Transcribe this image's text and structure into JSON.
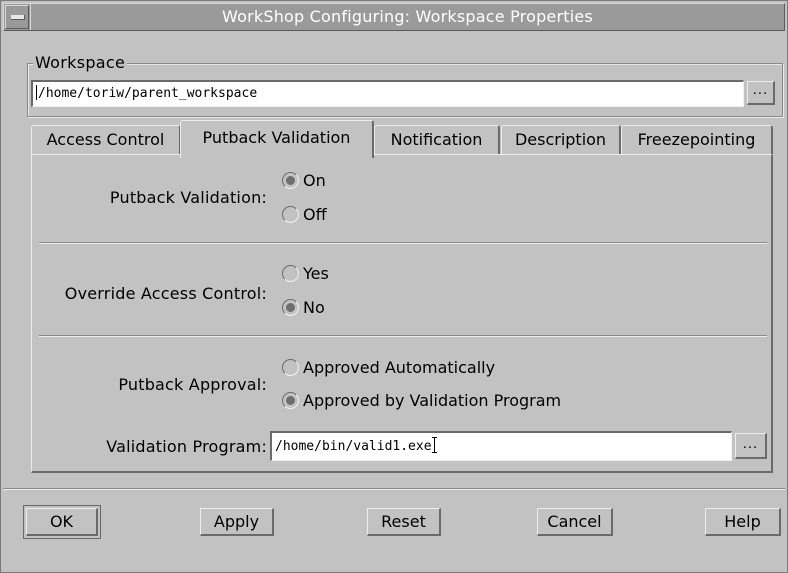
{
  "window": {
    "title": "WorkShop Configuring: Workspace Properties"
  },
  "workspace": {
    "label": "Workspace",
    "path": "/home/toriw/parent_workspace",
    "browse_label": "..."
  },
  "tabs": [
    {
      "label": "Access Control",
      "active": false
    },
    {
      "label": "Putback Validation",
      "active": true
    },
    {
      "label": "Notification",
      "active": false
    },
    {
      "label": "Description",
      "active": false
    },
    {
      "label": "Freezepointing",
      "active": false
    }
  ],
  "putback_validation": {
    "label": "Putback Validation:",
    "options": [
      "On",
      "Off"
    ],
    "selected": "On"
  },
  "override_access_control": {
    "label": "Override Access Control:",
    "options": [
      "Yes",
      "No"
    ],
    "selected": "No"
  },
  "putback_approval": {
    "label": "Putback Approval:",
    "options": [
      "Approved Automatically",
      "Approved by Validation Program"
    ],
    "selected": "Approved by Validation Program"
  },
  "validation_program": {
    "label": "Validation Program:",
    "value": "/home/bin/valid1.exe",
    "browse_label": "..."
  },
  "buttons": {
    "ok": "OK",
    "apply": "Apply",
    "reset": "Reset",
    "cancel": "Cancel",
    "help": "Help"
  },
  "colors": {
    "window_bg": "#c2c2c2",
    "titlebar_bg": "#9a9a9a",
    "title_text": "#ffffff"
  }
}
